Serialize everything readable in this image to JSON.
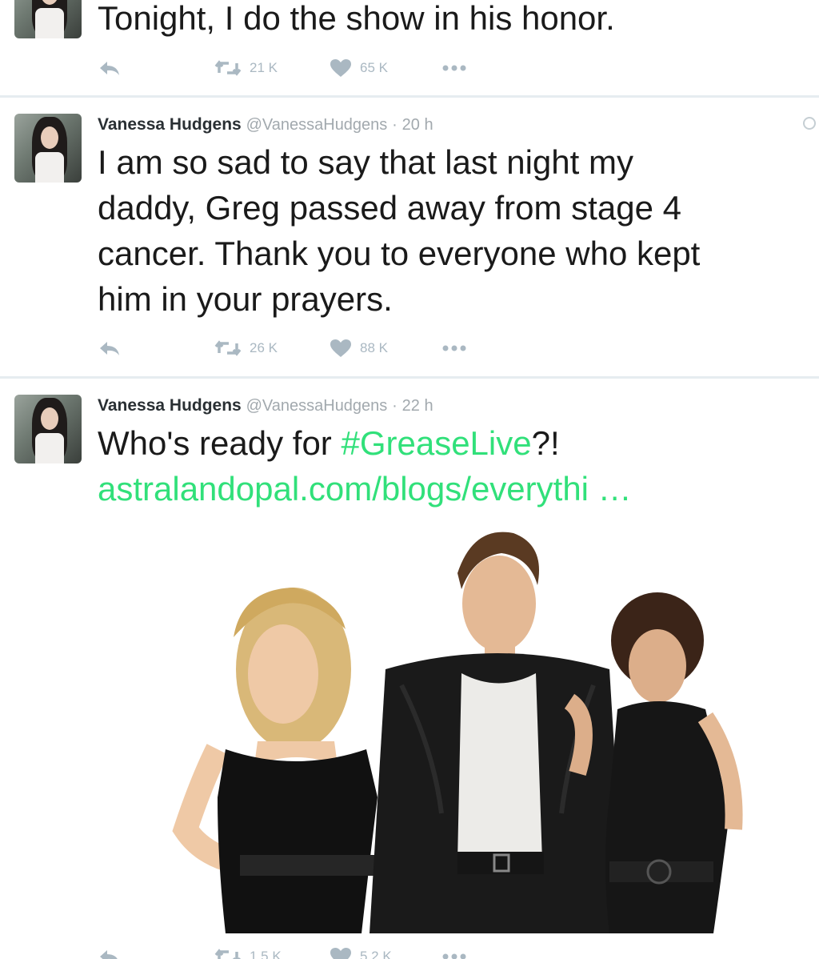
{
  "tweets": [
    {
      "text_lines": [
        "Tonight, I do the show in his honor."
      ],
      "retweets": "21 K",
      "likes": "65 K"
    },
    {
      "name": "Vanessa Hudgens",
      "handle": "@VanessaHudgens",
      "separator": "·",
      "time": "20 h",
      "text_lines": [
        "I am so sad to say that last night my",
        "daddy, Greg passed away from stage 4",
        "cancer. Thank you to everyone who kept",
        "him in your prayers."
      ],
      "retweets": "26 K",
      "likes": "88 K"
    },
    {
      "name": "Vanessa Hudgens",
      "handle": "@VanessaHudgens",
      "separator": "·",
      "time": "22 h",
      "text_prefix": "Who's ready for ",
      "hashtag": "#GreaseLive",
      "text_suffix": "?!",
      "link": "astralandopal.com/blogs/everythi …",
      "retweets": "1.5 K",
      "likes": "5.2 K"
    }
  ],
  "colors": {
    "link": "#31e07a",
    "action_icon": "#aab8c2",
    "meta": "#a2a9ae",
    "divider": "#e6ecf0"
  },
  "icons": [
    "reply-icon",
    "retweet-icon",
    "heart-icon",
    "more-icon",
    "caret-icon"
  ]
}
